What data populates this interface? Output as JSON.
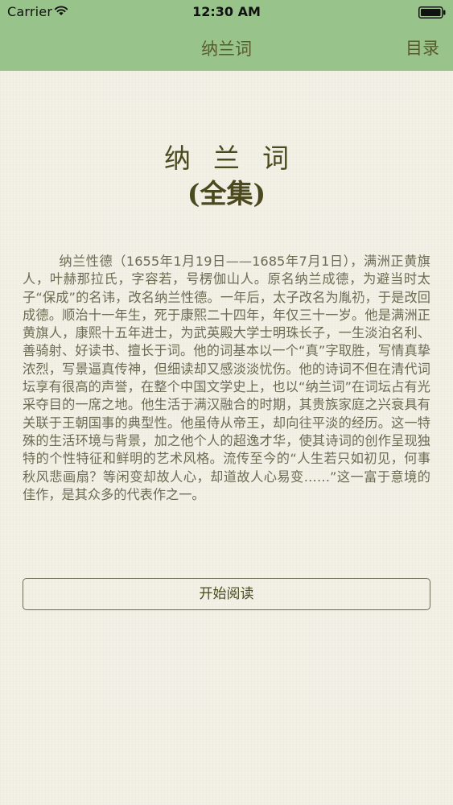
{
  "status_bar": {
    "carrier": "Carrier",
    "time": "12:30 AM",
    "wifi_icon": "wifi-icon",
    "battery_icon": "battery-icon"
  },
  "nav": {
    "title": "纳兰词",
    "right_button": "目录"
  },
  "book": {
    "title": "纳兰词",
    "subtitle": "(全集)",
    "intro": "纳兰性德（1655年1月19日——1685年7月1日），满洲正黄旗人，叶赫那拉氏，字容若，号楞伽山人。原名纳兰成德，为避当时太子“保成”的名讳，改名纳兰性德。一年后，太子改名为胤礽，于是改回成德。顺治十一年生，死于康熙二十四年，年仅三十一岁。他是满洲正黄旗人，康熙十五年进士，为武英殿大学士明珠长子，一生淡泊名利、善骑射、好读书、擅长于词。他的词基本以一个“真”字取胜，写情真挚浓烈，写景逼真传神，但细读却又感淡淡忧伤。他的诗词不但在清代词坛享有很高的声誉，在整个中国文学史上，也以“纳兰词”在词坛占有光采夺目的一席之地。他生活于满汉融合的时期，其贵族家庭之兴衰具有关联于王朝国事的典型性。他虽侍从帝王，却向往平淡的经历。这一特殊的生活环境与背景，加之他个人的超逸才华，使其诗词的创作呈现独特的个性特征和鲜明的艺术风格。流传至今的“人生若只如初见，何事秋风悲画扇？等闲变却故人心，却道故人心易变……”这一富于意境的佳作，是其众多的代表作之一。"
  },
  "actions": {
    "start_reading": "开始阅读"
  },
  "colors": {
    "nav_background": "#98c48b",
    "page_background": "#f3f0e6",
    "title_text": "#4b4a1f",
    "body_text": "#6b6b52"
  }
}
